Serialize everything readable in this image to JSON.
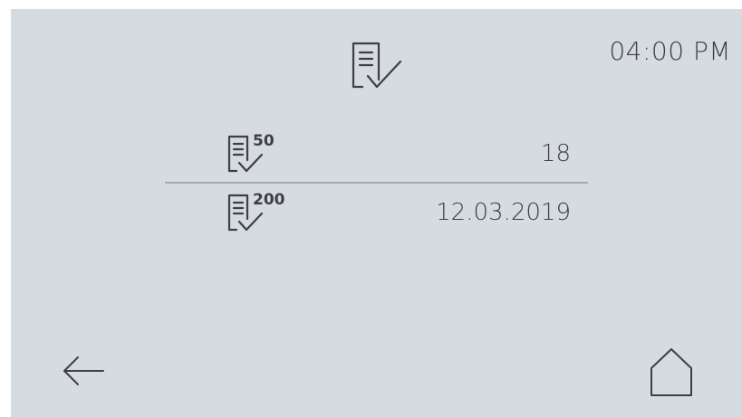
{
  "header": {
    "time": "04:00 PM",
    "title_icon": "checklist-icon"
  },
  "rows": [
    {
      "icon": "checklist-icon",
      "badge": "50",
      "value": "18"
    },
    {
      "icon": "checklist-icon",
      "badge": "200",
      "value": "12.03.2019"
    }
  ],
  "footer": {
    "back_icon": "arrow-left-icon",
    "home_icon": "home-icon"
  },
  "colors": {
    "background": "#d6dae1",
    "foreground": "#3d3f44",
    "divider": "#a7aaae"
  }
}
